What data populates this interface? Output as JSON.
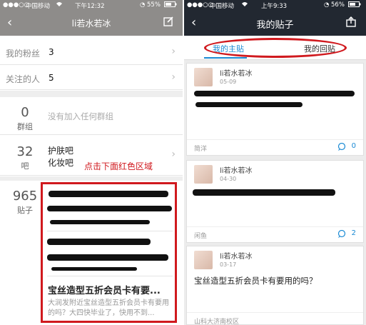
{
  "left": {
    "status": {
      "carrier": "中国移动",
      "wifi": "wifi-icon",
      "time": "下午12:32",
      "battery": "55%"
    },
    "nav": {
      "title": "li若水若冰",
      "back": "‹",
      "edit_icon": "edit-icon"
    },
    "rows": [
      {
        "label": "我的粉丝",
        "value": "3"
      },
      {
        "label": "关注的人",
        "value": "5"
      }
    ],
    "groups": {
      "count": "0",
      "label": "群组",
      "empty_text": "没有加入任何群组"
    },
    "bars": {
      "count": "32",
      "label": "吧",
      "names": [
        "护肤吧",
        "化妆吧"
      ],
      "annotation": "点击下面红色区域"
    },
    "posts": {
      "count": "965",
      "label": "贴子",
      "post_title": "宝丝造型五折会员卡有要...",
      "post_desc": "大润发附近宝丝造型五折会员卡有要用的吗？大四快毕业了，快用不到..."
    },
    "highlight_color": "#d0191e"
  },
  "right": {
    "status": {
      "carrier": "中国移动",
      "wifi": "wifi-icon",
      "time": "上午9:33",
      "battery": "56%"
    },
    "nav": {
      "title": "我的贴子",
      "back": "‹",
      "share_icon": "share-icon"
    },
    "tabs": [
      {
        "label": "我的主贴",
        "active": true
      },
      {
        "label": "我的回贴",
        "active": false
      }
    ],
    "cards": [
      {
        "username": "li若水若冰",
        "date": "05-09",
        "source": "简洋",
        "comments": "0"
      },
      {
        "username": "li若水若冰",
        "date": "04-30",
        "source": "闲鱼",
        "comments": "2"
      },
      {
        "username": "li若水若冰",
        "date": "03-17",
        "title": "宝丝造型五折会员卡有要用的吗？",
        "source": "山科大济南校区",
        "comments": ""
      }
    ],
    "accent_color": "#1a8ad4"
  }
}
